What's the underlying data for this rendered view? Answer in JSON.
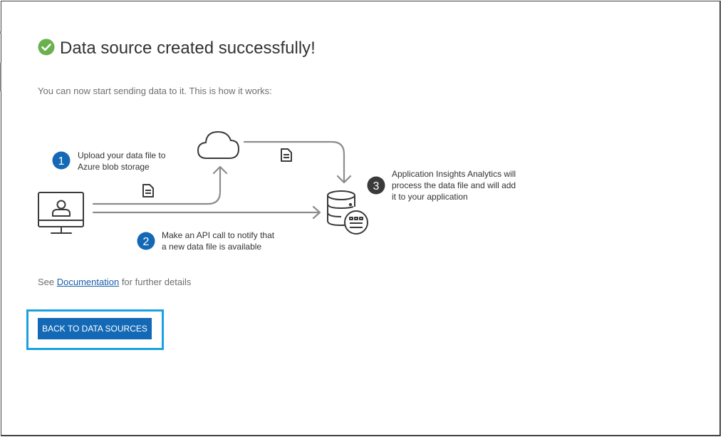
{
  "title": "Data source created successfully!",
  "subtitle": "You can now start sending data to it. This is how it works:",
  "steps": [
    {
      "number": "1",
      "line1": "Upload your data file to",
      "line2": "Azure blob storage"
    },
    {
      "number": "2",
      "line1": "Make an API call to notify that",
      "line2": "a new data file is available"
    },
    {
      "number": "3",
      "line1": "Application Insights Analytics will",
      "line2": "process the data file and will add",
      "line3": "it to your application"
    }
  ],
  "footer": {
    "prefix": "See ",
    "link": "Documentation",
    "suffix": " for further details"
  },
  "back_button": "BACK TO DATA SOURCES",
  "colors": {
    "success_green": "#6ab04c",
    "step_blue": "#1469b6",
    "step_dark": "#3a3a3a",
    "button_blue": "#1469b6",
    "focus_ring": "#1ba1e2",
    "line_gray": "#8c8c8c"
  },
  "icons": [
    "check-circle-icon",
    "computer-user-icon",
    "cloud-icon",
    "document-icon",
    "database-icon"
  ]
}
